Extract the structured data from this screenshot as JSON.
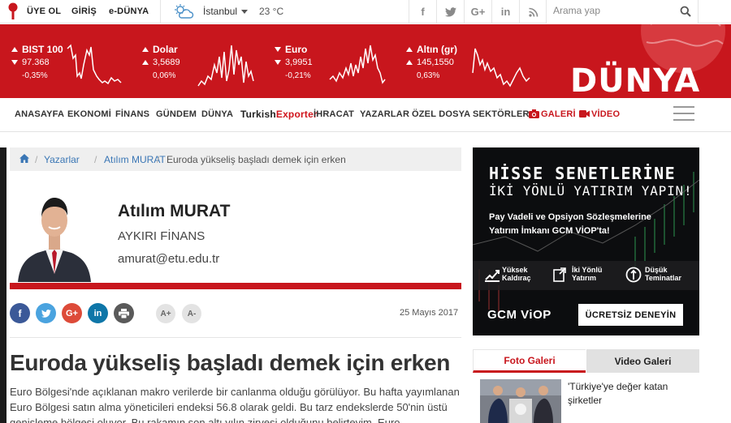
{
  "topbar": {
    "member_label": "ÜYE OL",
    "login_label": "GİRİŞ",
    "edunya_label": "e-DÜNYA",
    "city": "İstanbul",
    "temperature": "23 °C",
    "social": {
      "facebook": "f",
      "twitter": "t",
      "googleplus": "G+",
      "linkedin": "in",
      "rss": "rss"
    },
    "search_placeholder": "Arama yap"
  },
  "markets": [
    {
      "name": "BIST 100",
      "value": "97.368",
      "change": "-0,35%",
      "icon": "up-down-arrows"
    },
    {
      "name": "Dolar",
      "value": "3,5689",
      "change": "0,06%",
      "icon": "up-arrows"
    },
    {
      "name": "Euro",
      "value": "3,9951",
      "change": "-0,21%",
      "icon": "down-arrows"
    },
    {
      "name": "Altın (gr)",
      "value": "145,1550",
      "change": "0,63%",
      "icon": "up-arrows"
    }
  ],
  "brand": {
    "logo": "DÜNYA",
    "accent": "#c8161d"
  },
  "nav": {
    "items": [
      "ANASAYFA",
      "EKONOMİ",
      "FİNANS",
      "GÜNDEM",
      "DÜNYA"
    ],
    "turkish_exporter_a": "Turkish",
    "turkish_exporter_b": "Exporter",
    "items2": [
      "İHRACAT",
      "YAZARLAR",
      "ÖZEL DOSYA",
      "SEKTÖRLER"
    ],
    "gallery": "GALERİ",
    "video": "VİDEO"
  },
  "breadcrumb": {
    "home_icon": "home-icon",
    "writers": "Yazarlar",
    "author": "Atılım MURAT",
    "current": "Euroda yükseliş başladı demek için erken"
  },
  "author": {
    "name": "Atılım MURAT",
    "column": "AYKIRI FİNANS",
    "email": "amurat@etu.edu.tr"
  },
  "article": {
    "date": "25 Mayıs 2017",
    "font_increase": "A+",
    "font_decrease": "A-",
    "title": "Euroda yükseliş başladı demek için erken",
    "body": "Euro Bölgesi'nde açıklanan makro verilerde bir canlanma olduğu görülüyor. Bu hafta yayımlanan Euro Bölgesi satın alma yöneticileri endeksi 56.8 olarak geldi. Bu tarz endekslerde 50'nin üstü genişleme bölgesi oluyor. Bu rakamın son altı yılın zirvesi olduğunu belirteyim. Euro"
  },
  "ad": {
    "headline1": "HİSSE SENETLERİNE",
    "headline2": "İKİ YÖNLÜ YATIRIM YAPIN!",
    "text1": "Pay Vadeli ve Opsiyon Sözleşmelerine",
    "text2": "Yatırım İmkanı GCM VİOP'ta!",
    "features": [
      {
        "l1": "Yüksek",
        "l2": "Kaldıraç"
      },
      {
        "l1": "İki Yönlü",
        "l2": "Yatırım"
      },
      {
        "l1": "Düşük",
        "l2": "Teminatlar"
      }
    ],
    "brand": "GCM ViOP",
    "cta": "ÜCRETSİZ DENEYİN"
  },
  "gallery": {
    "tab_photo": "Foto Galeri",
    "tab_video": "Video Galeri",
    "caption": "'Türkiye'ye değer katan şirketler"
  }
}
